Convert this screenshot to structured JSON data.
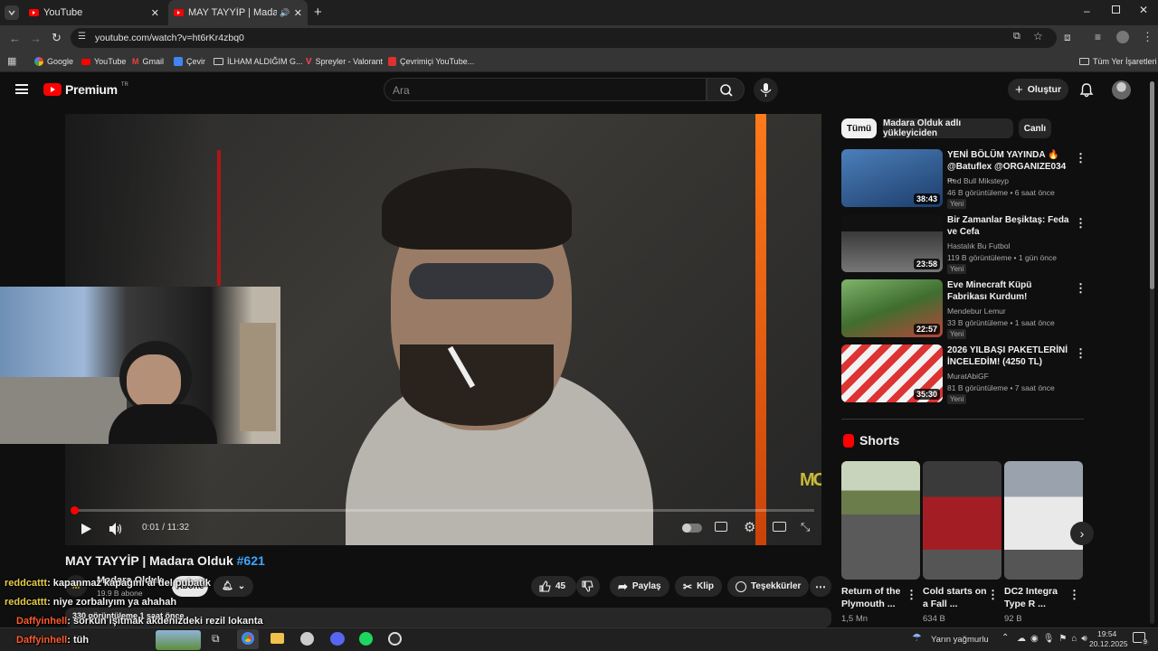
{
  "browser": {
    "tabs": [
      {
        "title": "YouTube",
        "active": false
      },
      {
        "title": "MAY TAYYİP | Madara Olduk",
        "active": true
      }
    ],
    "url": "youtube.com/watch?v=ht6rKr4zbq0",
    "bookmarks": [
      "Google",
      "YouTube",
      "Gmail",
      "Çevir",
      "İLHAM ALDIĞIM G...",
      "Spreyler - Valorant",
      "Çevrimiçi YouTube..."
    ],
    "all_bookmarks": "Tüm Yer İşaretleri"
  },
  "yt": {
    "logo": "Premium",
    "logo_sup": "TR",
    "search_placeholder": "Ara",
    "create": "Oluştur"
  },
  "player": {
    "time": "0:01 / 11:32",
    "watermark": "MO",
    "progress_fraction": 0.001
  },
  "video": {
    "title": "MAY TAYYİP | Madara Olduk",
    "hashtag": "#621",
    "channel": "Madara Olduk",
    "subs": "19.9 B abone",
    "sub_button": "Abone",
    "likes": "45",
    "share": "Paylaş",
    "clip": "Klip",
    "thanks": "Teşekkürler",
    "desc_meta": "330 görüntüleme 1 saat önce"
  },
  "chat": [
    {
      "user": "reddcattt",
      "text": ": kapanmaz kapağını al del pubatik",
      "color": "#e6cc4a"
    },
    {
      "user": "reddcattt",
      "text": ": niye zorbalıyım ya ahahah",
      "color": "#e6cc4a"
    },
    {
      "user": "Daffyinhell",
      "text": ": sorkun işitmak akdenizdeki rezil lokanta",
      "color": "#ff5a2e"
    },
    {
      "user": "Daffyinhell",
      "text": ": tüh",
      "color": "#ff5a2e"
    }
  ],
  "filters": [
    "Tümü",
    "Madara Olduk adlı yükleyiciden",
    "Canlı"
  ],
  "recommendations": [
    {
      "title": "YENİ BÖLÜM YAYINDA 🔥 @Batuflex @ORGANIZE034 ...",
      "channel": "Red Bull Mikstеyp",
      "meta": "46 B görüntüleme • 6 saat önce",
      "badge": "Yeni",
      "duration": "38:43",
      "color": "#3a6ea8"
    },
    {
      "title": "Bir Zamanlar Beşiktaş: Feda ve Cefa",
      "channel": "Hastalık Bu Futbol",
      "meta": "119 B görüntüleme • 1 gün önce",
      "badge": "Yeni",
      "duration": "23:58",
      "color": "#2a2a2a"
    },
    {
      "title": "Eve Minecraft Küpü Fabrikası Kurdum!",
      "channel": "Mendebur Lemur",
      "meta": "33 B görüntüleme • 1 saat önce",
      "badge": "Yeni",
      "duration": "22:57",
      "color": "#4f8a3c"
    },
    {
      "title": "2026 YILBAŞI PAKETLERİNİ İNCELEDİM! (4250 TL)",
      "channel": "MuratAbiGF",
      "meta": "81 B görüntüleme • 7 saat önce",
      "badge": "Yeni",
      "duration": "35:30",
      "color": "#b82b2b"
    }
  ],
  "shorts": {
    "heading": "Shorts",
    "items": [
      {
        "title": "Return of the Plymouth ...",
        "views": "1,5 Mn",
        "color": "#6b7d4a"
      },
      {
        "title": "Cold starts on a Fall ...",
        "views": "634 B",
        "color": "#8a1e22"
      },
      {
        "title": "DC2 Integra Type R ...",
        "views": "92 B",
        "color": "#9aa3ad"
      }
    ]
  },
  "taskbar": {
    "weather": "Yarın yağmurlu",
    "time": "19:54",
    "date": "20.12.2025",
    "notif": "9"
  },
  "colors": {
    "yt_red": "#ff0000",
    "link_blue": "#3ea6ff"
  }
}
